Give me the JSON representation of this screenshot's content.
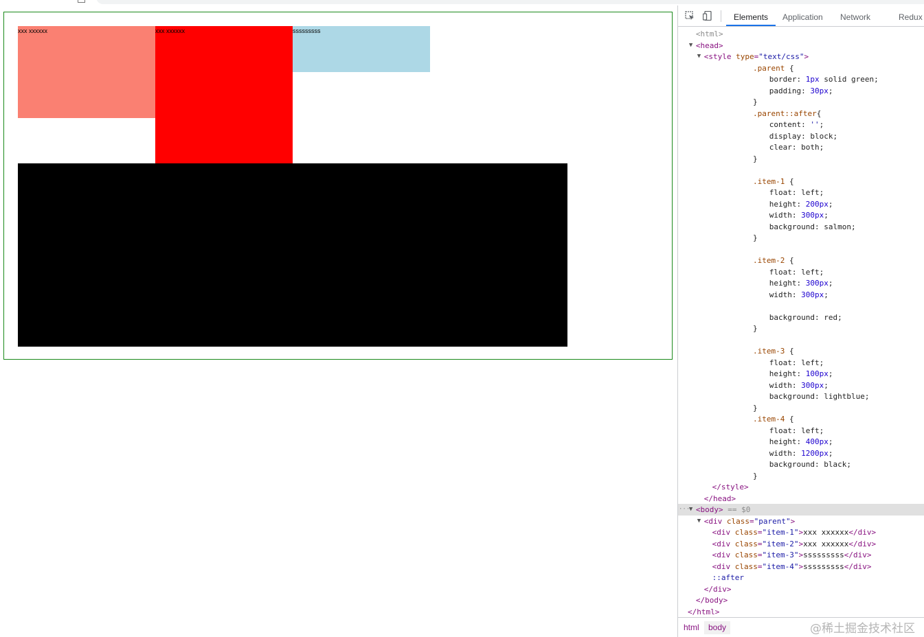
{
  "page": {
    "items": [
      {
        "class": "item-1",
        "text": "xxx xxxxxx",
        "color": "#fa8072"
      },
      {
        "class": "item-2",
        "text": "xxx xxxxxx",
        "color": "#ff0000"
      },
      {
        "class": "item-3",
        "text": "sssssssss",
        "color": "#add8e6"
      },
      {
        "class": "item-4",
        "text": "sssssssss",
        "color": "#000000"
      }
    ]
  },
  "devtools": {
    "tabs": [
      "Elements",
      "Application",
      "Network",
      "Redux"
    ],
    "active_tab": "Elements",
    "dom_lines": [
      {
        "indent": 1,
        "html": "<span class=\"muted\">&lt;html&gt;</span>"
      },
      {
        "indent": 1,
        "tri": "▼",
        "html": "<span class=\"tag\">&lt;head&gt;</span>"
      },
      {
        "indent": 2,
        "tri": "▼",
        "html": "<span class=\"tag\">&lt;style </span><span class=\"attr\">type</span><span class=\"tag\">=</span><span class=\"val\">\"text/css\"</span><span class=\"tag\">&gt;</span>"
      },
      {
        "indent": 8,
        "html": "<span class=\"sel\">.parent</span> {"
      },
      {
        "indent": 10,
        "html": "border: <span class=\"num\">1px</span> solid green;"
      },
      {
        "indent": 10,
        "html": "padding: <span class=\"num\">30px</span>;"
      },
      {
        "indent": 8,
        "html": "}"
      },
      {
        "indent": 8,
        "html": "<span class=\"sel\">.parent::after</span>{"
      },
      {
        "indent": 10,
        "html": "content: <span class=\"val\">''</span>;"
      },
      {
        "indent": 10,
        "html": "display: block;"
      },
      {
        "indent": 10,
        "html": "clear: both;"
      },
      {
        "indent": 8,
        "html": "}"
      },
      {
        "indent": 0,
        "html": ""
      },
      {
        "indent": 8,
        "html": "<span class=\"sel\">.item-1</span> {"
      },
      {
        "indent": 10,
        "html": "float: left;"
      },
      {
        "indent": 10,
        "html": "height: <span class=\"num\">200px</span>;"
      },
      {
        "indent": 10,
        "html": "width: <span class=\"num\">300px</span>;"
      },
      {
        "indent": 10,
        "html": "background: salmon;"
      },
      {
        "indent": 8,
        "html": "}"
      },
      {
        "indent": 0,
        "html": ""
      },
      {
        "indent": 8,
        "html": "<span class=\"sel\">.item-2</span> {"
      },
      {
        "indent": 10,
        "html": "float: left;"
      },
      {
        "indent": 10,
        "html": "height: <span class=\"num\">300px</span>;"
      },
      {
        "indent": 10,
        "html": "width: <span class=\"num\">300px</span>;"
      },
      {
        "indent": 0,
        "html": ""
      },
      {
        "indent": 10,
        "html": "background: red;"
      },
      {
        "indent": 8,
        "html": "}"
      },
      {
        "indent": 0,
        "html": ""
      },
      {
        "indent": 8,
        "html": "<span class=\"sel\">.item-3</span> {"
      },
      {
        "indent": 10,
        "html": "float: left;"
      },
      {
        "indent": 10,
        "html": "height: <span class=\"num\">100px</span>;"
      },
      {
        "indent": 10,
        "html": "width: <span class=\"num\">300px</span>;"
      },
      {
        "indent": 10,
        "html": "background: lightblue;"
      },
      {
        "indent": 8,
        "html": "}"
      },
      {
        "indent": 8,
        "html": "<span class=\"sel\">.item-4</span> {"
      },
      {
        "indent": 10,
        "html": "float: left;"
      },
      {
        "indent": 10,
        "html": "height: <span class=\"num\">400px</span>;"
      },
      {
        "indent": 10,
        "html": "width: <span class=\"num\">1200px</span>;"
      },
      {
        "indent": 10,
        "html": "background: black;"
      },
      {
        "indent": 8,
        "html": "}"
      },
      {
        "indent": 3,
        "html": "<span class=\"tag\">&lt;/style&gt;</span>"
      },
      {
        "indent": 2,
        "html": "<span class=\"tag\">&lt;/head&gt;</span>"
      },
      {
        "indent": 1,
        "tri": "▼",
        "dots": true,
        "selected": true,
        "html": "<span class=\"tag\">&lt;body&gt;</span> <span class=\"muted\">== $0</span>"
      },
      {
        "indent": 2,
        "tri": "▼",
        "html": "<span class=\"tag\">&lt;div </span><span class=\"attr\">class</span><span class=\"tag\">=</span><span class=\"val\">\"parent\"</span><span class=\"tag\">&gt;</span>"
      },
      {
        "indent": 3,
        "html": "<span class=\"tag\">&lt;div </span><span class=\"attr\">class</span><span class=\"tag\">=</span><span class=\"val\">\"item-1\"</span><span class=\"tag\">&gt;</span>xxx xxxxxx<span class=\"tag\">&lt;/div&gt;</span>"
      },
      {
        "indent": 3,
        "html": "<span class=\"tag\">&lt;div </span><span class=\"attr\">class</span><span class=\"tag\">=</span><span class=\"val\">\"item-2\"</span><span class=\"tag\">&gt;</span>xxx xxxxxx<span class=\"tag\">&lt;/div&gt;</span>"
      },
      {
        "indent": 3,
        "html": "<span class=\"tag\">&lt;div </span><span class=\"attr\">class</span><span class=\"tag\">=</span><span class=\"val\">\"item-3\"</span><span class=\"tag\">&gt;</span>sssssssss<span class=\"tag\">&lt;/div&gt;</span>"
      },
      {
        "indent": 3,
        "html": "<span class=\"tag\">&lt;div </span><span class=\"attr\">class</span><span class=\"tag\">=</span><span class=\"val\">\"item-4\"</span><span class=\"tag\">&gt;</span>sssssssss<span class=\"tag\">&lt;/div&gt;</span>"
      },
      {
        "indent": 3,
        "html": "<span class=\"pseudo\">::after</span>"
      },
      {
        "indent": 2,
        "html": "<span class=\"tag\">&lt;/div&gt;</span>"
      },
      {
        "indent": 1,
        "html": "<span class=\"tag\">&lt;/body&gt;</span>"
      },
      {
        "indent": 0,
        "html": "<span class=\"tag\">&lt;/html&gt;</span>"
      }
    ],
    "breadcrumbs": [
      "html",
      "body"
    ],
    "watermark": "@稀土掘金技术社区"
  }
}
